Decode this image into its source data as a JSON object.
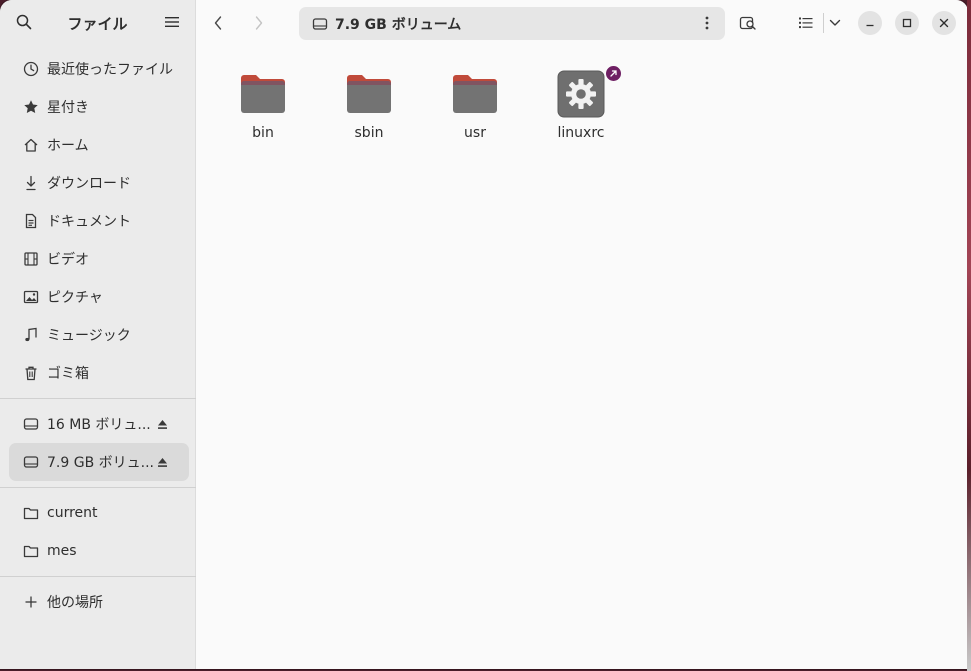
{
  "sidebar": {
    "title": "ファイル",
    "places": [
      {
        "label": "最近使ったファイル",
        "icon": "clock-icon"
      },
      {
        "label": "星付き",
        "icon": "star-icon"
      },
      {
        "label": "ホーム",
        "icon": "home-icon"
      },
      {
        "label": "ダウンロード",
        "icon": "download-icon"
      },
      {
        "label": "ドキュメント",
        "icon": "document-icon"
      },
      {
        "label": "ビデオ",
        "icon": "video-icon"
      },
      {
        "label": "ピクチャ",
        "icon": "picture-icon"
      },
      {
        "label": "ミュージック",
        "icon": "music-icon"
      },
      {
        "label": "ゴミ箱",
        "icon": "trash-icon"
      }
    ],
    "devices": [
      {
        "label": "16 MB ボリュ...",
        "icon": "drive-icon",
        "active": false
      },
      {
        "label": "7.9 GB ボリュ...",
        "icon": "drive-icon",
        "active": true
      }
    ],
    "bookmarks": [
      {
        "label": "current",
        "icon": "folder-icon"
      },
      {
        "label": "mes",
        "icon": "folder-icon"
      }
    ],
    "other_locations": {
      "label": "他の場所",
      "icon": "plus-icon"
    }
  },
  "toolbar": {
    "path": "7.9 GB ボリューム"
  },
  "files": [
    {
      "name": "bin",
      "type": "folder"
    },
    {
      "name": "sbin",
      "type": "folder"
    },
    {
      "name": "usr",
      "type": "folder"
    },
    {
      "name": "linuxrc",
      "type": "executable-link"
    }
  ],
  "colors": {
    "accent": "#6e1f63",
    "folder_tab": "#c04a3a",
    "folder_body": "#737373"
  }
}
